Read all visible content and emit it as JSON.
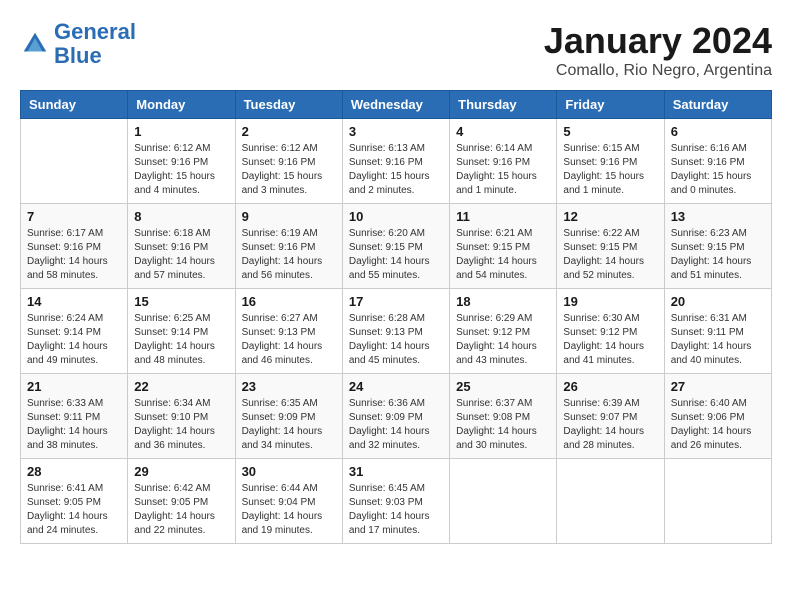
{
  "header": {
    "logo_line1": "General",
    "logo_line2": "Blue",
    "month": "January 2024",
    "location": "Comallo, Rio Negro, Argentina"
  },
  "weekdays": [
    "Sunday",
    "Monday",
    "Tuesday",
    "Wednesday",
    "Thursday",
    "Friday",
    "Saturday"
  ],
  "weeks": [
    [
      {
        "day": "",
        "info": ""
      },
      {
        "day": "1",
        "info": "Sunrise: 6:12 AM\nSunset: 9:16 PM\nDaylight: 15 hours\nand 4 minutes."
      },
      {
        "day": "2",
        "info": "Sunrise: 6:12 AM\nSunset: 9:16 PM\nDaylight: 15 hours\nand 3 minutes."
      },
      {
        "day": "3",
        "info": "Sunrise: 6:13 AM\nSunset: 9:16 PM\nDaylight: 15 hours\nand 2 minutes."
      },
      {
        "day": "4",
        "info": "Sunrise: 6:14 AM\nSunset: 9:16 PM\nDaylight: 15 hours\nand 1 minute."
      },
      {
        "day": "5",
        "info": "Sunrise: 6:15 AM\nSunset: 9:16 PM\nDaylight: 15 hours\nand 1 minute."
      },
      {
        "day": "6",
        "info": "Sunrise: 6:16 AM\nSunset: 9:16 PM\nDaylight: 15 hours\nand 0 minutes."
      }
    ],
    [
      {
        "day": "7",
        "info": "Sunrise: 6:17 AM\nSunset: 9:16 PM\nDaylight: 14 hours\nand 58 minutes."
      },
      {
        "day": "8",
        "info": "Sunrise: 6:18 AM\nSunset: 9:16 PM\nDaylight: 14 hours\nand 57 minutes."
      },
      {
        "day": "9",
        "info": "Sunrise: 6:19 AM\nSunset: 9:16 PM\nDaylight: 14 hours\nand 56 minutes."
      },
      {
        "day": "10",
        "info": "Sunrise: 6:20 AM\nSunset: 9:15 PM\nDaylight: 14 hours\nand 55 minutes."
      },
      {
        "day": "11",
        "info": "Sunrise: 6:21 AM\nSunset: 9:15 PM\nDaylight: 14 hours\nand 54 minutes."
      },
      {
        "day": "12",
        "info": "Sunrise: 6:22 AM\nSunset: 9:15 PM\nDaylight: 14 hours\nand 52 minutes."
      },
      {
        "day": "13",
        "info": "Sunrise: 6:23 AM\nSunset: 9:15 PM\nDaylight: 14 hours\nand 51 minutes."
      }
    ],
    [
      {
        "day": "14",
        "info": "Sunrise: 6:24 AM\nSunset: 9:14 PM\nDaylight: 14 hours\nand 49 minutes."
      },
      {
        "day": "15",
        "info": "Sunrise: 6:25 AM\nSunset: 9:14 PM\nDaylight: 14 hours\nand 48 minutes."
      },
      {
        "day": "16",
        "info": "Sunrise: 6:27 AM\nSunset: 9:13 PM\nDaylight: 14 hours\nand 46 minutes."
      },
      {
        "day": "17",
        "info": "Sunrise: 6:28 AM\nSunset: 9:13 PM\nDaylight: 14 hours\nand 45 minutes."
      },
      {
        "day": "18",
        "info": "Sunrise: 6:29 AM\nSunset: 9:12 PM\nDaylight: 14 hours\nand 43 minutes."
      },
      {
        "day": "19",
        "info": "Sunrise: 6:30 AM\nSunset: 9:12 PM\nDaylight: 14 hours\nand 41 minutes."
      },
      {
        "day": "20",
        "info": "Sunrise: 6:31 AM\nSunset: 9:11 PM\nDaylight: 14 hours\nand 40 minutes."
      }
    ],
    [
      {
        "day": "21",
        "info": "Sunrise: 6:33 AM\nSunset: 9:11 PM\nDaylight: 14 hours\nand 38 minutes."
      },
      {
        "day": "22",
        "info": "Sunrise: 6:34 AM\nSunset: 9:10 PM\nDaylight: 14 hours\nand 36 minutes."
      },
      {
        "day": "23",
        "info": "Sunrise: 6:35 AM\nSunset: 9:09 PM\nDaylight: 14 hours\nand 34 minutes."
      },
      {
        "day": "24",
        "info": "Sunrise: 6:36 AM\nSunset: 9:09 PM\nDaylight: 14 hours\nand 32 minutes."
      },
      {
        "day": "25",
        "info": "Sunrise: 6:37 AM\nSunset: 9:08 PM\nDaylight: 14 hours\nand 30 minutes."
      },
      {
        "day": "26",
        "info": "Sunrise: 6:39 AM\nSunset: 9:07 PM\nDaylight: 14 hours\nand 28 minutes."
      },
      {
        "day": "27",
        "info": "Sunrise: 6:40 AM\nSunset: 9:06 PM\nDaylight: 14 hours\nand 26 minutes."
      }
    ],
    [
      {
        "day": "28",
        "info": "Sunrise: 6:41 AM\nSunset: 9:05 PM\nDaylight: 14 hours\nand 24 minutes."
      },
      {
        "day": "29",
        "info": "Sunrise: 6:42 AM\nSunset: 9:05 PM\nDaylight: 14 hours\nand 22 minutes."
      },
      {
        "day": "30",
        "info": "Sunrise: 6:44 AM\nSunset: 9:04 PM\nDaylight: 14 hours\nand 19 minutes."
      },
      {
        "day": "31",
        "info": "Sunrise: 6:45 AM\nSunset: 9:03 PM\nDaylight: 14 hours\nand 17 minutes."
      },
      {
        "day": "",
        "info": ""
      },
      {
        "day": "",
        "info": ""
      },
      {
        "day": "",
        "info": ""
      }
    ]
  ]
}
